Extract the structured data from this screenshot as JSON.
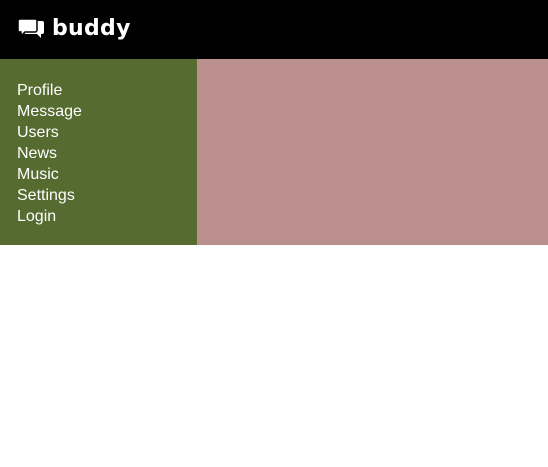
{
  "header": {
    "brand": "buddy",
    "logo_icon": "chat-bubbles-icon",
    "background": "#000000"
  },
  "sidebar": {
    "background": "#556b2f",
    "items": [
      {
        "label": "Profile"
      },
      {
        "label": "Message"
      },
      {
        "label": "Users"
      },
      {
        "label": "News"
      },
      {
        "label": "Music"
      },
      {
        "label": "Settings"
      },
      {
        "label": "Login"
      }
    ]
  },
  "content": {
    "background": "#bc8f8f"
  }
}
